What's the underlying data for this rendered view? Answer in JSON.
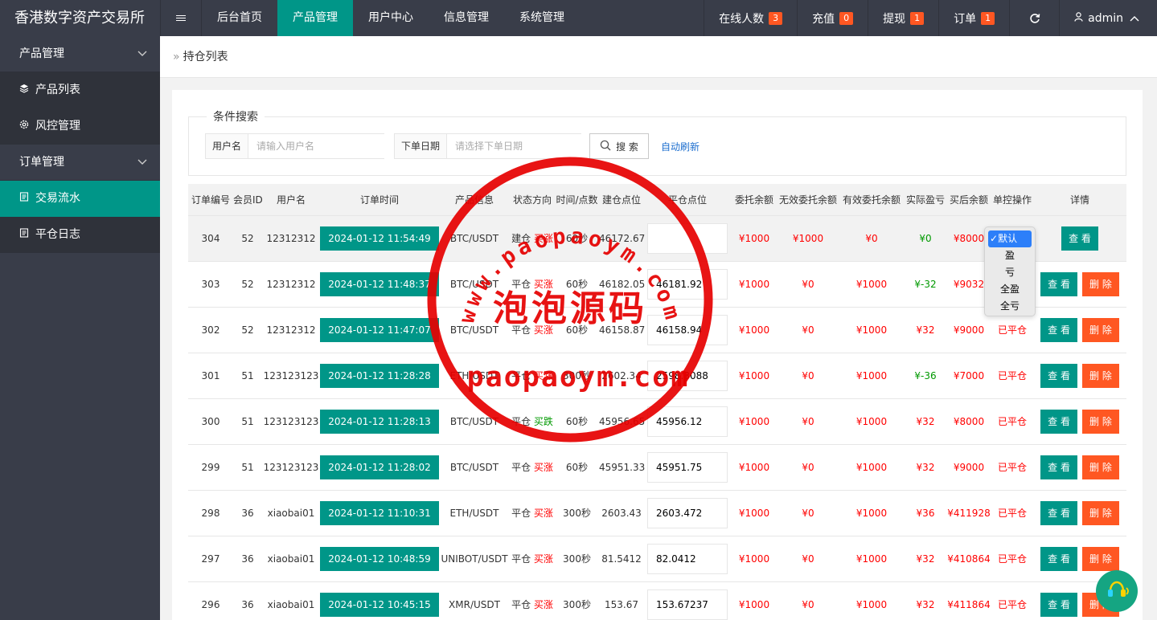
{
  "app": {
    "title": "香港数字资产交易所"
  },
  "nav": {
    "items": [
      {
        "label": "后台首页",
        "active": false
      },
      {
        "label": "产品管理",
        "active": true
      },
      {
        "label": "用户中心",
        "active": false
      },
      {
        "label": "信息管理",
        "active": false
      },
      {
        "label": "系统管理",
        "active": false
      }
    ],
    "online": {
      "label": "在线人数",
      "count": "3"
    },
    "recharge": {
      "label": "充值",
      "count": "0"
    },
    "withdraw": {
      "label": "提现",
      "count": "1"
    },
    "orders": {
      "label": "订单",
      "count": "1"
    },
    "user": "admin"
  },
  "sidebar": {
    "product_group": "产品管理",
    "product_list": "产品列表",
    "risk_control": "风控管理",
    "order_group": "订单管理",
    "trade_flow": "交易流水",
    "close_log": "平仓日志"
  },
  "breadcrumb": "持仓列表",
  "search": {
    "legend": "条件搜索",
    "username_label": "用户名",
    "username_placeholder": "请输入用户名",
    "date_label": "下单日期",
    "date_placeholder": "请选择下单日期",
    "search_button": "搜 索",
    "auto_refresh": "自动刷新"
  },
  "table": {
    "headers": [
      "订单编号",
      "会员ID",
      "用户名",
      "订单时间",
      "产品信息",
      "状态方向",
      "时间/点数",
      "建仓点位",
      "平仓点位",
      "委托余额",
      "无效委托余额",
      "有效委托余额",
      "实际盈亏",
      "买后余额",
      "单控操作",
      "详情"
    ],
    "rows": [
      {
        "id": "304",
        "member": "52",
        "user": "12312312",
        "time": "2024-01-12 11:54:49",
        "product": "BTC/USDT",
        "state": "建仓",
        "dir": "买涨",
        "dur": "60秒",
        "open": "46172.67",
        "close": "",
        "entrust": "¥1000",
        "invalid": "¥1000",
        "valid": "¥0",
        "pnl": "¥0",
        "pnl_color": "green",
        "after": "¥8000",
        "ctrl": "",
        "view": "查 看",
        "del": ""
      },
      {
        "id": "303",
        "member": "52",
        "user": "12312312",
        "time": "2024-01-12 11:48:37",
        "product": "BTC/USDT",
        "state": "平仓",
        "dir": "买涨",
        "dur": "60秒",
        "open": "46182.05",
        "close": "46181.92",
        "entrust": "¥1000",
        "invalid": "¥0",
        "valid": "¥1000",
        "pnl": "¥-32",
        "pnl_color": "green",
        "after": "¥9032",
        "ctrl": "",
        "view": "查 看",
        "del": "删 除"
      },
      {
        "id": "302",
        "member": "52",
        "user": "12312312",
        "time": "2024-01-12 11:47:07",
        "product": "BTC/USDT",
        "state": "平仓",
        "dir": "买涨",
        "dur": "60秒",
        "open": "46158.87",
        "close": "46158.94",
        "entrust": "¥1000",
        "invalid": "¥0",
        "valid": "¥1000",
        "pnl": "¥32",
        "pnl_color": "red",
        "after": "¥9000",
        "ctrl": "已平仓",
        "view": "查 看",
        "del": "删 除"
      },
      {
        "id": "301",
        "member": "51",
        "user": "123123123",
        "time": "2024-01-12 11:28:28",
        "product": "ETH/USDT",
        "state": "平仓",
        "dir": "买涨",
        "dur": "300秒",
        "open": "2602.34",
        "close": "2598.3088",
        "entrust": "¥1000",
        "invalid": "¥0",
        "valid": "¥1000",
        "pnl": "¥-36",
        "pnl_color": "green",
        "after": "¥7000",
        "ctrl": "已平仓",
        "view": "查 看",
        "del": "删 除"
      },
      {
        "id": "300",
        "member": "51",
        "user": "123123123",
        "time": "2024-01-12 11:28:13",
        "product": "BTC/USDT",
        "state": "平仓",
        "dir": "买跌",
        "dir_color": "green",
        "dur": "60秒",
        "open": "45956.65",
        "close": "45956.12",
        "entrust": "¥1000",
        "invalid": "¥0",
        "valid": "¥1000",
        "pnl": "¥32",
        "pnl_color": "red",
        "after": "¥8000",
        "ctrl": "已平仓",
        "view": "查 看",
        "del": "删 除"
      },
      {
        "id": "299",
        "member": "51",
        "user": "123123123",
        "time": "2024-01-12 11:28:02",
        "product": "BTC/USDT",
        "state": "平仓",
        "dir": "买涨",
        "dur": "60秒",
        "open": "45951.33",
        "close": "45951.75",
        "entrust": "¥1000",
        "invalid": "¥0",
        "valid": "¥1000",
        "pnl": "¥32",
        "pnl_color": "red",
        "after": "¥9000",
        "ctrl": "已平仓",
        "view": "查 看",
        "del": "删 除"
      },
      {
        "id": "298",
        "member": "36",
        "user": "xiaobai01",
        "time": "2024-01-12 11:10:31",
        "product": "ETH/USDT",
        "state": "平仓",
        "dir": "买涨",
        "dur": "300秒",
        "open": "2603.43",
        "close": "2603.472",
        "entrust": "¥1000",
        "invalid": "¥0",
        "valid": "¥1000",
        "pnl": "¥36",
        "pnl_color": "red",
        "after": "¥411928",
        "ctrl": "已平仓",
        "view": "查 看",
        "del": "删 除"
      },
      {
        "id": "297",
        "member": "36",
        "user": "xiaobai01",
        "time": "2024-01-12 10:48:59",
        "product": "UNIBOT/USDT",
        "state": "平仓",
        "dir": "买涨",
        "dur": "300秒",
        "open": "81.5412",
        "close": "82.0412",
        "entrust": "¥1000",
        "invalid": "¥0",
        "valid": "¥1000",
        "pnl": "¥32",
        "pnl_color": "red",
        "after": "¥410864",
        "ctrl": "已平仓",
        "view": "查 看",
        "del": "删 除"
      },
      {
        "id": "296",
        "member": "36",
        "user": "xiaobai01",
        "time": "2024-01-12 10:45:15",
        "product": "XMR/USDT",
        "state": "平仓",
        "dir": "买涨",
        "dur": "300秒",
        "open": "153.67",
        "close": "153.67237",
        "entrust": "¥1000",
        "invalid": "¥0",
        "valid": "¥1000",
        "pnl": "¥32",
        "pnl_color": "red",
        "after": "¥411864",
        "ctrl": "已平仓",
        "view": "查 看",
        "del": "删 除"
      }
    ]
  },
  "control_dropdown": {
    "options": [
      "默认",
      "盈",
      "亏",
      "全盈",
      "全亏"
    ],
    "selected": "默认"
  },
  "watermark": {
    "line_top": "www.paopaoym.com",
    "line_mid": "泡泡源码",
    "line_bottom": "paopaoym.com"
  },
  "colors": {
    "header_bg": "#393d49",
    "accent": "#009688",
    "badge": "#ff5722",
    "profit": "#ff0000",
    "loss": "#009900",
    "stamp": "#e60000"
  },
  "icons": [
    "menu-icon",
    "refresh-icon",
    "user-icon",
    "chevron-up-icon",
    "chevron-down-icon",
    "layers-icon",
    "gear-icon",
    "list-icon",
    "search-icon",
    "chat-icon"
  ]
}
